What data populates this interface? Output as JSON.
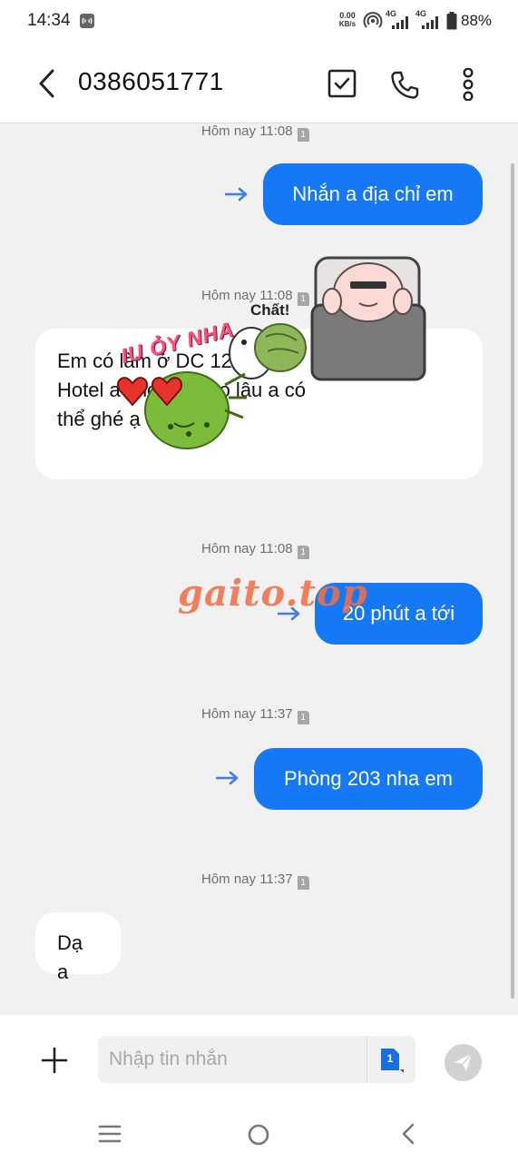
{
  "status_bar": {
    "time": "14:34",
    "net_speed_value": "0.00",
    "net_speed_unit": "KB/s",
    "network_1": "4G",
    "network_2": "4G",
    "battery": "88%"
  },
  "header": {
    "contact": "0386051771",
    "icons": [
      "back-arrow-icon",
      "select-checkbox-icon",
      "phone-icon",
      "more-vert-icon"
    ]
  },
  "messages": [
    {
      "timestamp": "Hôm nay 11:08",
      "sim": "1",
      "direction": "sent",
      "text": "Nhắn a địa chỉ em"
    },
    {
      "timestamp": "Hôm nay 11:08",
      "sim": "1",
      "direction": "received",
      "lines": [
        "Em có làm ở DC 12",
        "Hotel a khoảng bao lâu a có",
        "thể ghé ạ"
      ]
    },
    {
      "timestamp": "Hôm nay 11:08",
      "sim": "1",
      "direction": "sent",
      "text": "20 phút a tới"
    },
    {
      "timestamp": "Hôm nay 11:37",
      "sim": "1",
      "direction": "sent",
      "text": "Phòng 203 nha em"
    },
    {
      "timestamp": "Hôm nay 11:37",
      "sim": "1",
      "direction": "received",
      "text": "Dạ a"
    }
  ],
  "stickers": {
    "love_text": "IU ỎY NHA",
    "chat_text": "Chất!"
  },
  "watermark": "gaito.top",
  "composer": {
    "placeholder": "Nhập tin nhắn",
    "sim_label": "1",
    "icons": [
      "add-icon",
      "sim-card-icon",
      "send-icon"
    ]
  },
  "nav_bar": {
    "icons": [
      "recents-icon",
      "home-icon",
      "back-icon"
    ]
  },
  "colors": {
    "sent_bubble": "#1578f5",
    "received_bubble": "#ffffff",
    "chat_background": "#f1f1f1",
    "sent_arrow": "#3e7cf0"
  }
}
